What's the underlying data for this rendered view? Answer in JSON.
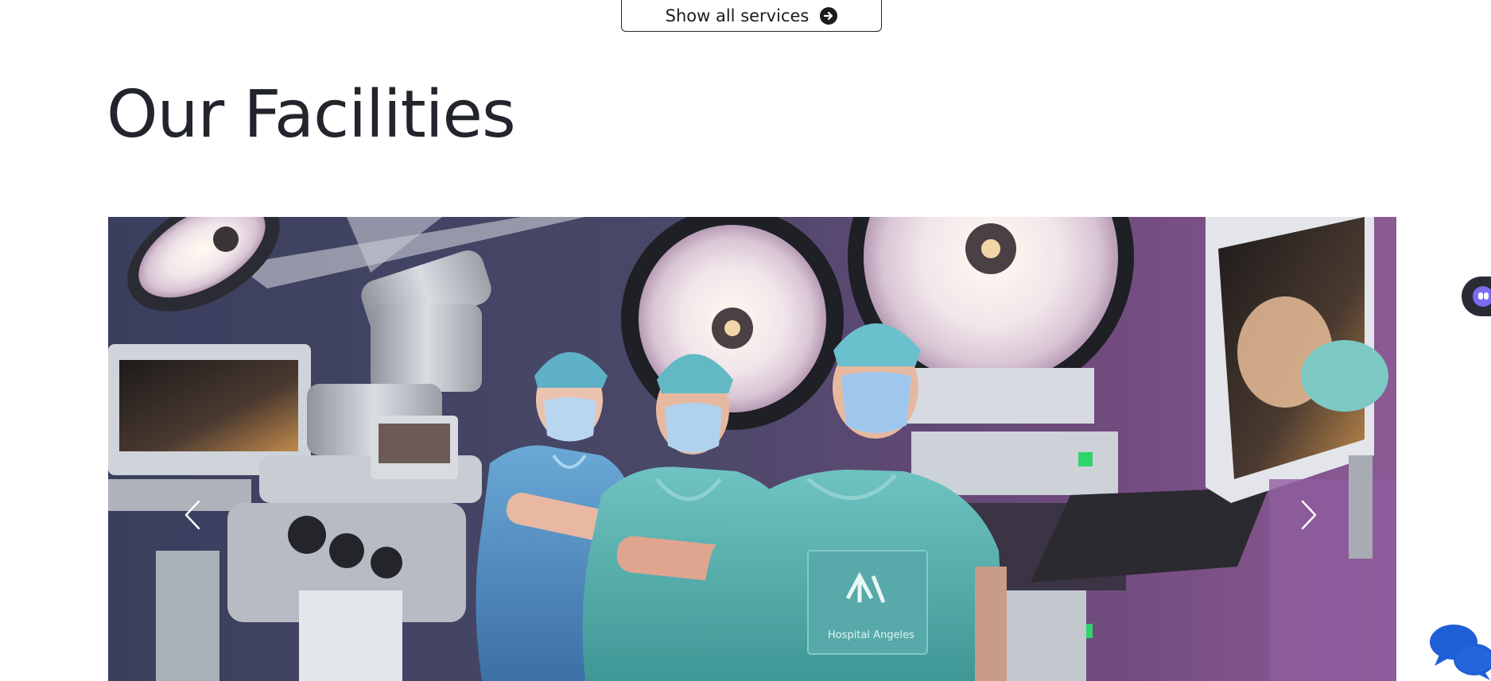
{
  "services_button": {
    "label": "Show all services",
    "icon": "arrow-right-circle-icon"
  },
  "facilities": {
    "title": "Our Facilities"
  },
  "carousel": {
    "slide_image": "operating-room-surgeons-photo",
    "scrub_pocket_text": "Hospital Angeles",
    "prev_icon": "chevron-left-icon",
    "next_icon": "chevron-right-icon"
  },
  "widgets": {
    "side_widget_icon": "assistant-face-icon",
    "chat_icon": "chat-bubbles-icon"
  },
  "colors": {
    "text": "#22252b",
    "button_border": "#22252b",
    "scrub_teal": "#5fb6b5",
    "cap_teal": "#6cc1c6",
    "room_purple": "#7a4f86",
    "chat_blue": "#1f5fd6",
    "widget_dark": "#2a2c33"
  }
}
